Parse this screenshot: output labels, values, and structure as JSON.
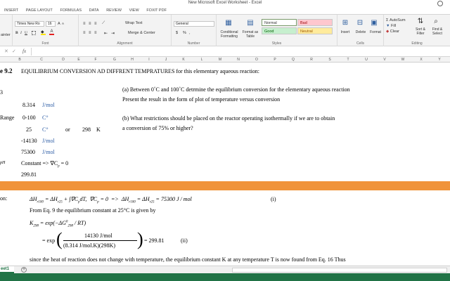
{
  "window": {
    "title": "New Microsoft Excel Worksheet - Excel",
    "user_icon": "user-icon"
  },
  "tabs": [
    "INSERT",
    "PAGE LAYOUT",
    "FORMULAS",
    "DATA",
    "REVIEW",
    "VIEW",
    "FOXIT PDF"
  ],
  "ribbon": {
    "clipboard": {
      "paste_partial": "ainter",
      "label": ""
    },
    "font": {
      "name": "Times New Ro",
      "size": "16",
      "bold": "B",
      "italic": "I",
      "underline": "U",
      "grow": "A",
      "shrink": "A",
      "label": "Font"
    },
    "alignment": {
      "wrap": "Wrap Text",
      "merge": "Merge & Center",
      "label": "Alignment"
    },
    "number": {
      "format": "General",
      "currency": "$",
      "percent": "%",
      "comma": ",",
      "label": "Number"
    },
    "styles": {
      "conditional": "Conditional",
      "conditional2": "Formatting",
      "format_as": "Format as",
      "format_as2": "Table",
      "normal": "Normal",
      "bad": "Bad",
      "good": "Good",
      "neutral": "Neutral",
      "label": "Styles"
    },
    "cells": {
      "insert": "Insert",
      "delete": "Delete",
      "format": "Format",
      "label": "Cells"
    },
    "editing": {
      "autosum": "AutoSum",
      "fill": "Fill",
      "clear": "Clear",
      "sort1": "Sort &",
      "sort2": "Filter",
      "find1": "Find &",
      "find2": "Select",
      "label": "Editing"
    }
  },
  "formula_bar": {
    "fx": "fx",
    "cancel": "✕",
    "enter": "✓"
  },
  "columns": [
    "B",
    "C",
    "D",
    "E",
    "F",
    "G",
    "H",
    "I",
    "J",
    "K",
    "L",
    "M",
    "N",
    "O",
    "P",
    "Q",
    "R",
    "S",
    "T",
    "U",
    "V",
    "W",
    "X",
    "Y"
  ],
  "sheet": {
    "heading_id": "e 9.2",
    "heading_text": "EQUILIBRIUM CONVERSION AD DIFFRENT TEMPRATURES for this elementary aqueous reaction:",
    "left_labels": [
      "Range",
      "pH"
    ],
    "r_value": "8.314",
    "r_unit": "J/mol",
    "range_value": "0-100",
    "range_unit": "C°",
    "temp_c": "25",
    "temp_c_unit": "C°",
    "or": "or",
    "temp_k": "298",
    "temp_k_unit": "K",
    "h_value": "-14130",
    "h_unit": "J/mol",
    "hr_value": "75300",
    "hr_unit": "J/mol",
    "cp_text": "Constant => ∇C",
    "cp_sub": "p",
    "cp_tail": "= 0",
    "k_value": "299.81",
    "q_a1": "(a) Between 0˚C and 100˚C detrmine the equilibrium conversion for the elementary aqueous reaction",
    "q_a2": "Present the result in the form of plot of temperature versus conversion",
    "q_b1": "(b) What restrictions should be placed on the reactor operating isothermally if we are to obtain",
    "q_b2": "a conversion of 75% or higher?",
    "solution_label": "on:",
    "eq1": "ΔH",
    "eq1_tail": "= 75300 J / mol",
    "eq1_num": "(i)",
    "eq2_text": "From Eq. 9 the equilibrium constant at 25°C is given by",
    "eq3": "K",
    "eq4_num": "14130 J/mol",
    "eq4_den": "(8.314 J/mol.K)(298K)",
    "eq4_result": "= 299.81",
    "eq4_tag": "(ii)",
    "eq5": "since the heat of reaction does not change with temperature, the equilibrium constant K at any temperature T is now found from Eq. 16 Thus"
  },
  "sheettab": {
    "name": "eet1",
    "add": "+"
  }
}
